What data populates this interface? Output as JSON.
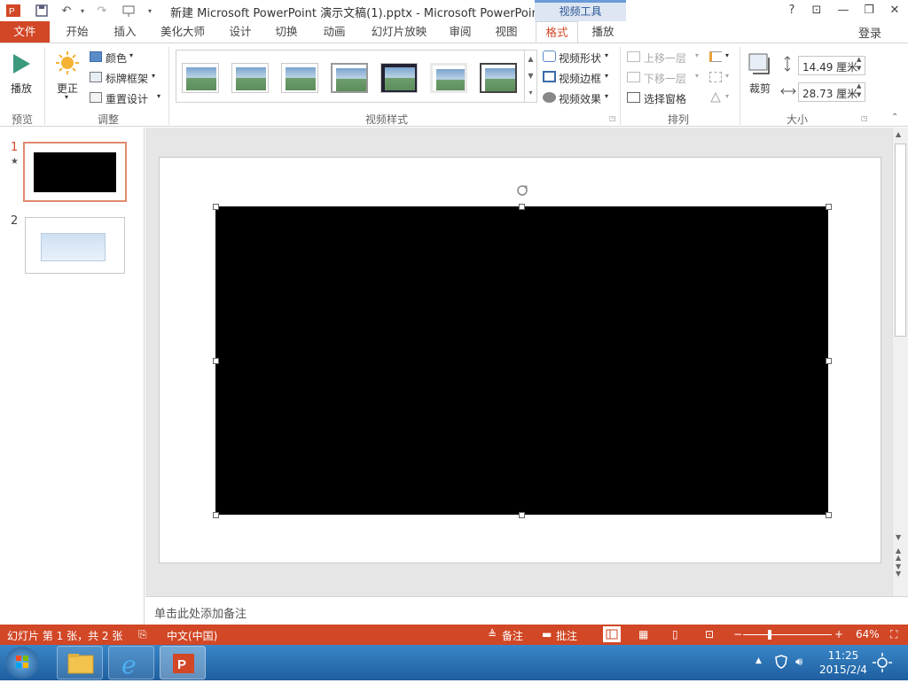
{
  "window": {
    "title": "新建 Microsoft PowerPoint 演示文稿(1).pptx - Microsoft PowerPoint",
    "context_tab_group": "视频工具",
    "controls": {
      "help": "?",
      "ribbon_options": "⊡",
      "minimize": "—",
      "restore": "❐",
      "close": "✕"
    }
  },
  "quick_access": {
    "undo_icon": "↶",
    "redo_icon": "↷"
  },
  "tabs": [
    "文件",
    "开始",
    "插入",
    "美化大师",
    "设计",
    "切换",
    "动画",
    "幻灯片放映",
    "审阅",
    "视图",
    "格式",
    "播放"
  ],
  "active_tab": "格式",
  "login": "登录",
  "ribbon": {
    "preview": {
      "play": "播放",
      "label": "预览"
    },
    "adjust": {
      "correct": "更正",
      "color": "颜色",
      "poster_frame": "标牌框架",
      "reset_design": "重置设计",
      "label": "调整"
    },
    "video_styles": {
      "label": "视频样式",
      "shape": "视频形状",
      "border": "视频边框",
      "effects": "视频效果"
    },
    "arrange": {
      "bring_forward": "上移一层",
      "send_backward": "下移一层",
      "selection_pane": "选择窗格",
      "label": "排列"
    },
    "size": {
      "crop": "裁剪",
      "height": "14.49 厘米",
      "width": "28.73 厘米",
      "label": "大小"
    }
  },
  "slides": [
    {
      "number": "1",
      "star": "★"
    },
    {
      "number": "2"
    }
  ],
  "notes_placeholder": "单击此处添加备注",
  "status": {
    "slide_info": "幻灯片 第 1 张，共 2 张",
    "language": "中文(中国)",
    "notes": "备注",
    "comments": "批注",
    "zoom": "64%",
    "zoom_level": 0.64
  },
  "taskbar": {
    "time": "11:25",
    "date": "2015/2/4"
  },
  "colors": {
    "accent": "#d24726",
    "context_blue": "#2b5797",
    "taskbar": "#2a73b8"
  }
}
